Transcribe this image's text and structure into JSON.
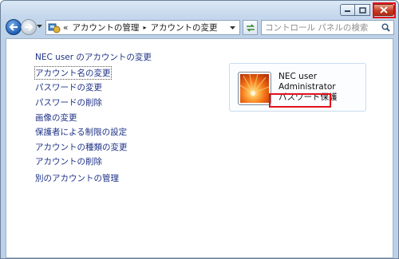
{
  "window": {
    "minimize_label": "minimize",
    "maximize_label": "maximize",
    "close_label": "close"
  },
  "address": {
    "overflow": "«",
    "crumbs": [
      "アカウントの管理",
      "アカウントの変更"
    ],
    "separator": "▸"
  },
  "search": {
    "placeholder": "コントロール パネルの検索"
  },
  "main": {
    "heading": "NEC user のアカウントの変更",
    "links": [
      "アカウント名の変更",
      "パスワードの変更",
      "パスワードの削除",
      "画像の変更",
      "保護者による制限の設定",
      "アカウントの種類の変更",
      "アカウントの削除",
      "別のアカウントの管理"
    ]
  },
  "user_card": {
    "name": "NEC user",
    "role": "Administrator",
    "status": "パスワード保護"
  },
  "colors": {
    "link": "#1e3287",
    "highlight": "#e1121c"
  }
}
